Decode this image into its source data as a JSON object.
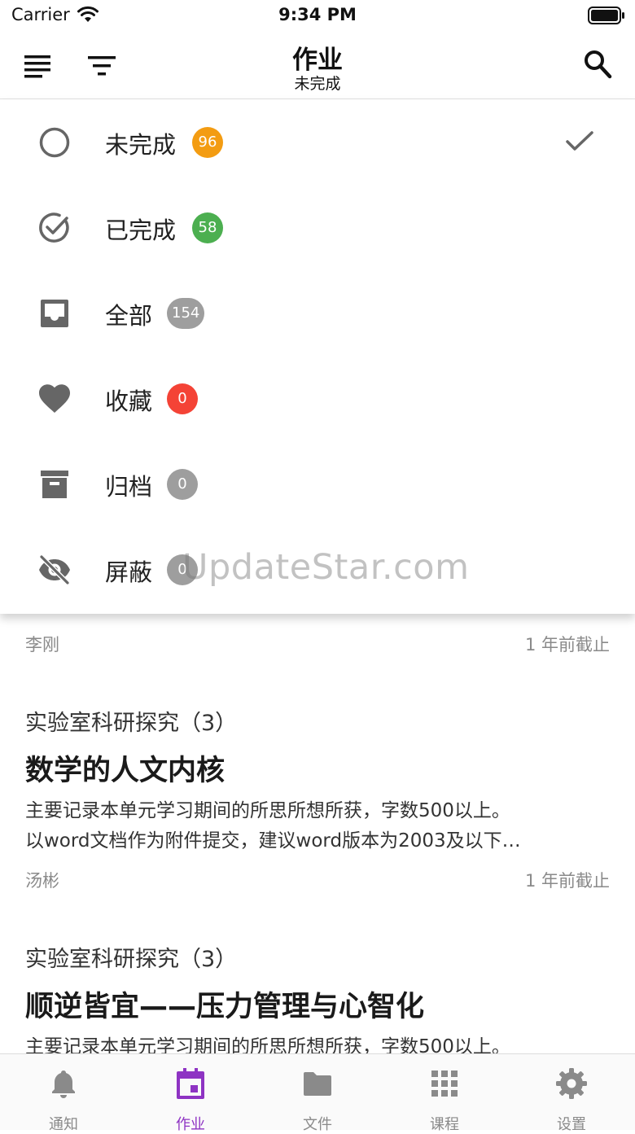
{
  "status_bar": {
    "carrier": "Carrier",
    "time": "9:34 PM"
  },
  "header": {
    "title": "作业",
    "subtitle": "未完成"
  },
  "filter_menu": {
    "items": [
      {
        "label": "未完成",
        "count": "96",
        "badge_color": "#f39c12",
        "icon": "circle-outline-icon",
        "selected": true
      },
      {
        "label": "已完成",
        "count": "58",
        "badge_color": "#4caf50",
        "icon": "check-circle-icon"
      },
      {
        "label": "全部",
        "count": "154",
        "badge_color": "#9e9e9e",
        "icon": "inbox-icon"
      },
      {
        "label": "收藏",
        "count": "0",
        "badge_color": "#f44336",
        "icon": "heart-icon"
      },
      {
        "label": "归档",
        "count": "0",
        "badge_color": "#9e9e9e",
        "icon": "archive-icon"
      },
      {
        "label": "屏蔽",
        "count": "0",
        "badge_color": "#9e9e9e",
        "icon": "eye-off-icon"
      }
    ]
  },
  "watermark": "UpdateStar.com",
  "homework_list": [
    {
      "teacher": "李刚",
      "deadline": "1 年前截止"
    },
    {
      "course": "实验室科研探究（3）",
      "title": "数学的人文内核",
      "desc_line1": "主要记录本单元学习期间的所思所想所获，字数500以上。",
      "desc_line2": "以word文档作为附件提交，建议word版本为2003及以下…",
      "teacher": "汤彬",
      "deadline": "1 年前截止"
    },
    {
      "course": "实验室科研探究（3）",
      "title": "顺逆皆宜——压力管理与心智化",
      "desc_line1": "主要记录本单元学习期间的所思所想所获，字数500以上。"
    }
  ],
  "tab_bar": {
    "active_color": "#8e33c3",
    "tabs": [
      {
        "label": "通知",
        "icon": "bell-icon"
      },
      {
        "label": "作业",
        "icon": "calendar-icon",
        "active": true
      },
      {
        "label": "文件",
        "icon": "folder-icon"
      },
      {
        "label": "课程",
        "icon": "grid-icon"
      },
      {
        "label": "设置",
        "icon": "gear-icon"
      }
    ]
  }
}
